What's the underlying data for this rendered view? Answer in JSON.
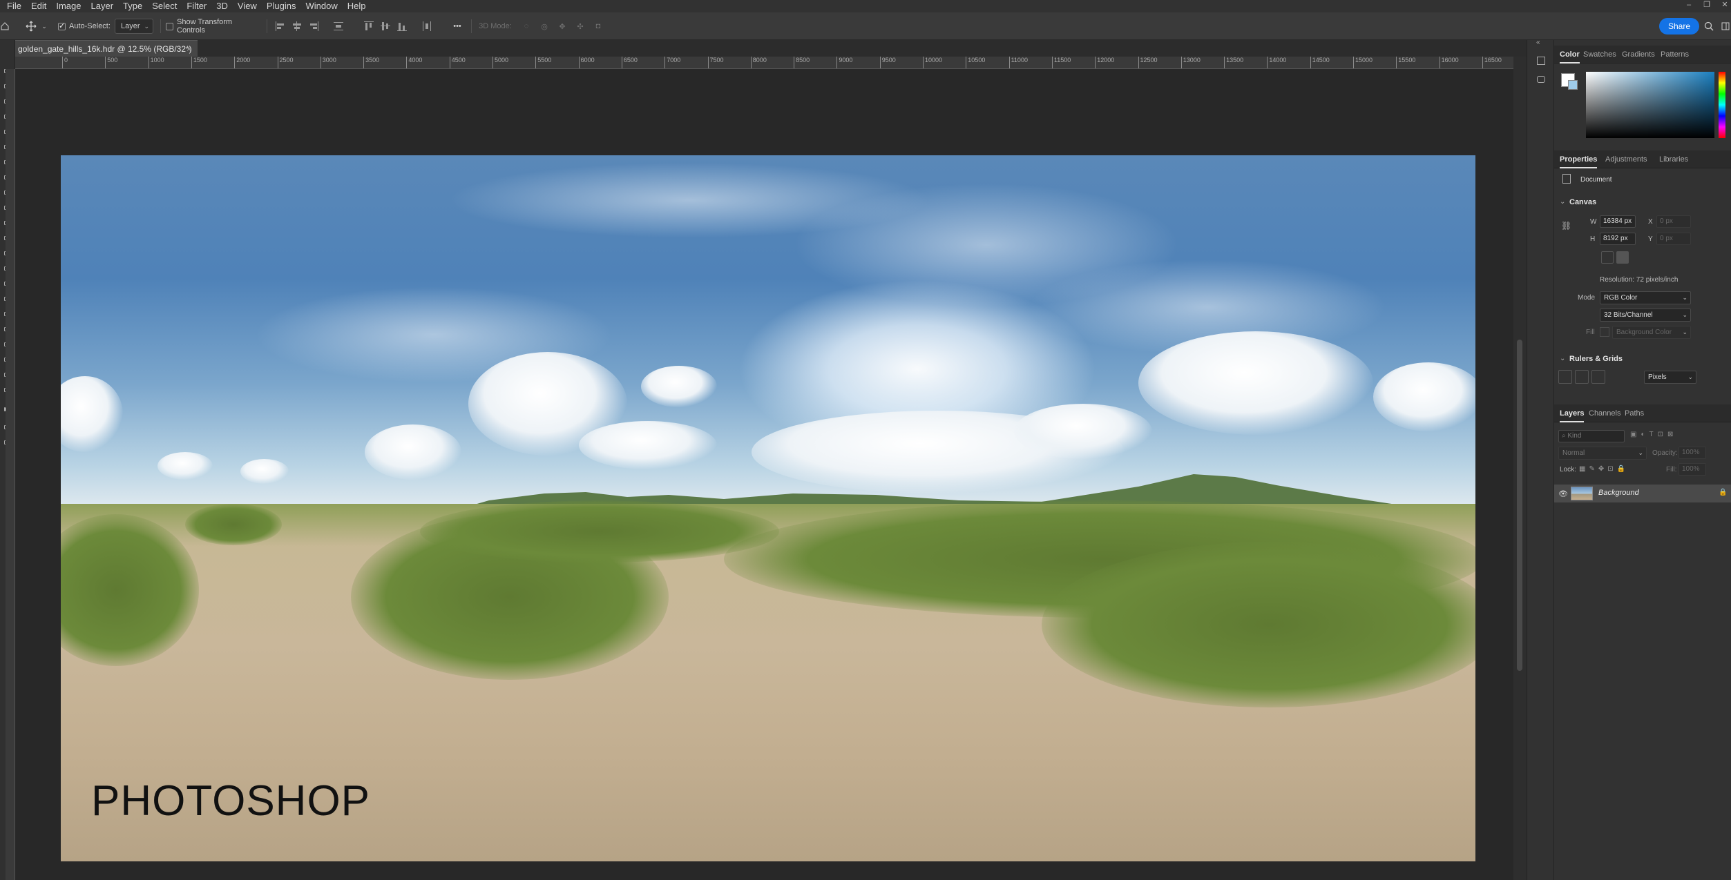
{
  "menu": [
    "File",
    "Edit",
    "Image",
    "Layer",
    "Type",
    "Select",
    "Filter",
    "3D",
    "View",
    "Plugins",
    "Window",
    "Help"
  ],
  "options": {
    "auto_select_label": "Auto-Select:",
    "auto_select_checked": true,
    "auto_select_target": "Layer",
    "transform_controls_label": "Show Transform Controls",
    "more": "•••",
    "mode_3d_label": "3D Mode:",
    "share_label": "Share"
  },
  "document": {
    "tab_title": "golden_gate_hills_16k.hdr @ 12.5% (RGB/32*)",
    "close_glyph": "×",
    "watermark": "PHOTOSHOP"
  },
  "ruler": {
    "ticks": [
      "0",
      "500",
      "1000",
      "1500",
      "2000",
      "2500",
      "3000",
      "3500",
      "4000",
      "4500",
      "5000",
      "5500",
      "6000",
      "6500",
      "7000",
      "7500",
      "8000",
      "8500",
      "9000",
      "9500",
      "10000",
      "10500",
      "11000",
      "11500",
      "12000",
      "12500",
      "13000",
      "13500",
      "14000",
      "14500",
      "15000",
      "15500",
      "16000",
      "16500"
    ]
  },
  "color_panel": {
    "tabs": [
      "Color",
      "Swatches",
      "Gradients",
      "Patterns"
    ],
    "active_tab": "Color",
    "picker_hue_color": "#1a7fc0"
  },
  "properties_panel": {
    "tabs": [
      "Properties",
      "Adjustments",
      "Libraries"
    ],
    "active_tab": "Properties",
    "doc_label": "Document",
    "canvas_section": "Canvas",
    "w_label": "W",
    "w_value": "16384 px",
    "h_label": "H",
    "h_value": "8192 px",
    "x_label": "X",
    "x_value": "0 px",
    "y_label": "Y",
    "y_value": "0 px",
    "resolution": "Resolution: 72 pixels/inch",
    "mode_label": "Mode",
    "mode_value": "RGB Color",
    "bits_value": "32 Bits/Channel",
    "fill_label": "Fill",
    "fill_value": "Background Color",
    "rulers_section": "Rulers & Grids",
    "units_value": "Pixels"
  },
  "layers_panel": {
    "tabs": [
      "Layers",
      "Channels",
      "Paths"
    ],
    "active_tab": "Layers",
    "kind_placeholder": "Kind",
    "blend_mode": "Normal",
    "opacity_label": "Opacity:",
    "opacity_value": "100%",
    "lock_label": "Lock:",
    "fill_label": "Fill:",
    "fill_value": "100%",
    "layers": [
      {
        "name": "Background",
        "visible": true,
        "locked": true
      }
    ]
  }
}
